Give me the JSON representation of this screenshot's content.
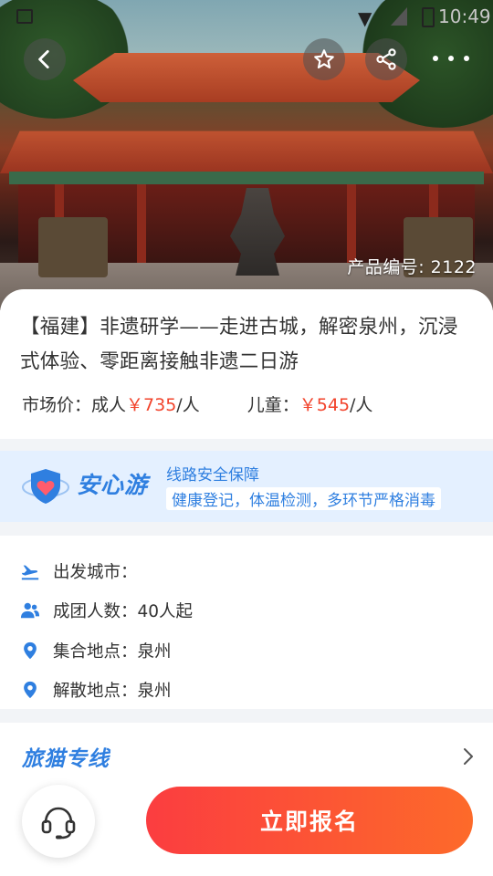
{
  "status_bar": {
    "time": "10:49"
  },
  "hero": {
    "product_number": "产品编号: 2122",
    "icons": {
      "back": "back-arrow-icon",
      "favorite": "star-icon",
      "share": "share-icon",
      "more": "more-dots-icon"
    }
  },
  "product": {
    "title": "【福建】非遗研学——走进古城，解密泉州，沉浸式体验、零距离接触非遗二日游",
    "market_price_label": "市场价：",
    "adult_label": "成人",
    "adult_price": "￥735",
    "adult_unit": "/人",
    "child_label": "儿童：",
    "child_price": "￥545",
    "child_unit": "/人",
    "price_color": "#f2432b"
  },
  "safety_banner": {
    "brand": "安心游",
    "headline": "线路安全保障",
    "detail": "健康登记，体温检测，多环节严格消毒",
    "accent": "#2f7fe0"
  },
  "info": {
    "departure": "出发城市：",
    "group_size": "成团人数：40人起",
    "meeting_point": "集合地点：泉州",
    "dismissal_point": "解散地点：泉州"
  },
  "zhuanxian": {
    "title": "旅猫专线"
  },
  "bottom_bar": {
    "signup_label": "立即报名",
    "signup_gradient": [
      "#fb3d40",
      "#fd6a2a"
    ]
  }
}
